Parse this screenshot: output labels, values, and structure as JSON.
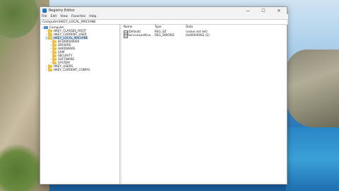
{
  "window": {
    "title": "Registry Editor",
    "controls": {
      "minimize": "—",
      "maximize": "☐",
      "close": "✕"
    }
  },
  "menu": [
    "File",
    "Edit",
    "View",
    "Favorites",
    "Help"
  ],
  "address": "Computer\\HKEY_LOCAL_MACHINE",
  "tree": [
    {
      "label": "Computer",
      "level": 0,
      "expanded": true,
      "icon": "computer-icon"
    },
    {
      "label": "HKEY_CLASSES_ROOT",
      "level": 1,
      "expanded": false,
      "icon": "folder-icon"
    },
    {
      "label": "HKEY_CURRENT_USER",
      "level": 1,
      "expanded": false,
      "icon": "folder-icon"
    },
    {
      "label": "HKEY_LOCAL_MACHINE",
      "level": 1,
      "expanded": true,
      "icon": "folder-icon",
      "selected": true
    },
    {
      "label": "BCD00000000",
      "level": 2,
      "expanded": false,
      "icon": "folder-icon"
    },
    {
      "label": "DRIVERS",
      "level": 2,
      "expanded": false,
      "icon": "folder-icon"
    },
    {
      "label": "HARDWARE",
      "level": 2,
      "expanded": false,
      "icon": "folder-icon"
    },
    {
      "label": "SAM",
      "level": 2,
      "expanded": false,
      "icon": "folder-icon"
    },
    {
      "label": "SECURITY",
      "level": 2,
      "expanded": false,
      "icon": "folder-icon"
    },
    {
      "label": "SOFTWARE",
      "level": 2,
      "expanded": false,
      "icon": "folder-icon"
    },
    {
      "label": "SYSTEM",
      "level": 2,
      "expanded": false,
      "icon": "folder-icon"
    },
    {
      "label": "HKEY_USERS",
      "level": 1,
      "expanded": false,
      "icon": "folder-icon"
    },
    {
      "label": "HKEY_CURRENT_CONFIG",
      "level": 1,
      "expanded": false,
      "icon": "folder-icon"
    }
  ],
  "list": {
    "headers": [
      "Name",
      "Type",
      "Data"
    ],
    "rows": [
      {
        "name": "(Default)",
        "type": "REG_SZ",
        "data": "(value not set)",
        "icon": "ab"
      },
      {
        "name": "ServiceLastKno...",
        "type": "REG_DWORD",
        "data": "0x00000002 (2)",
        "icon": "01"
      }
    ]
  },
  "colors": {
    "accent": "#cce4f7",
    "folder": "#e8c24a"
  }
}
